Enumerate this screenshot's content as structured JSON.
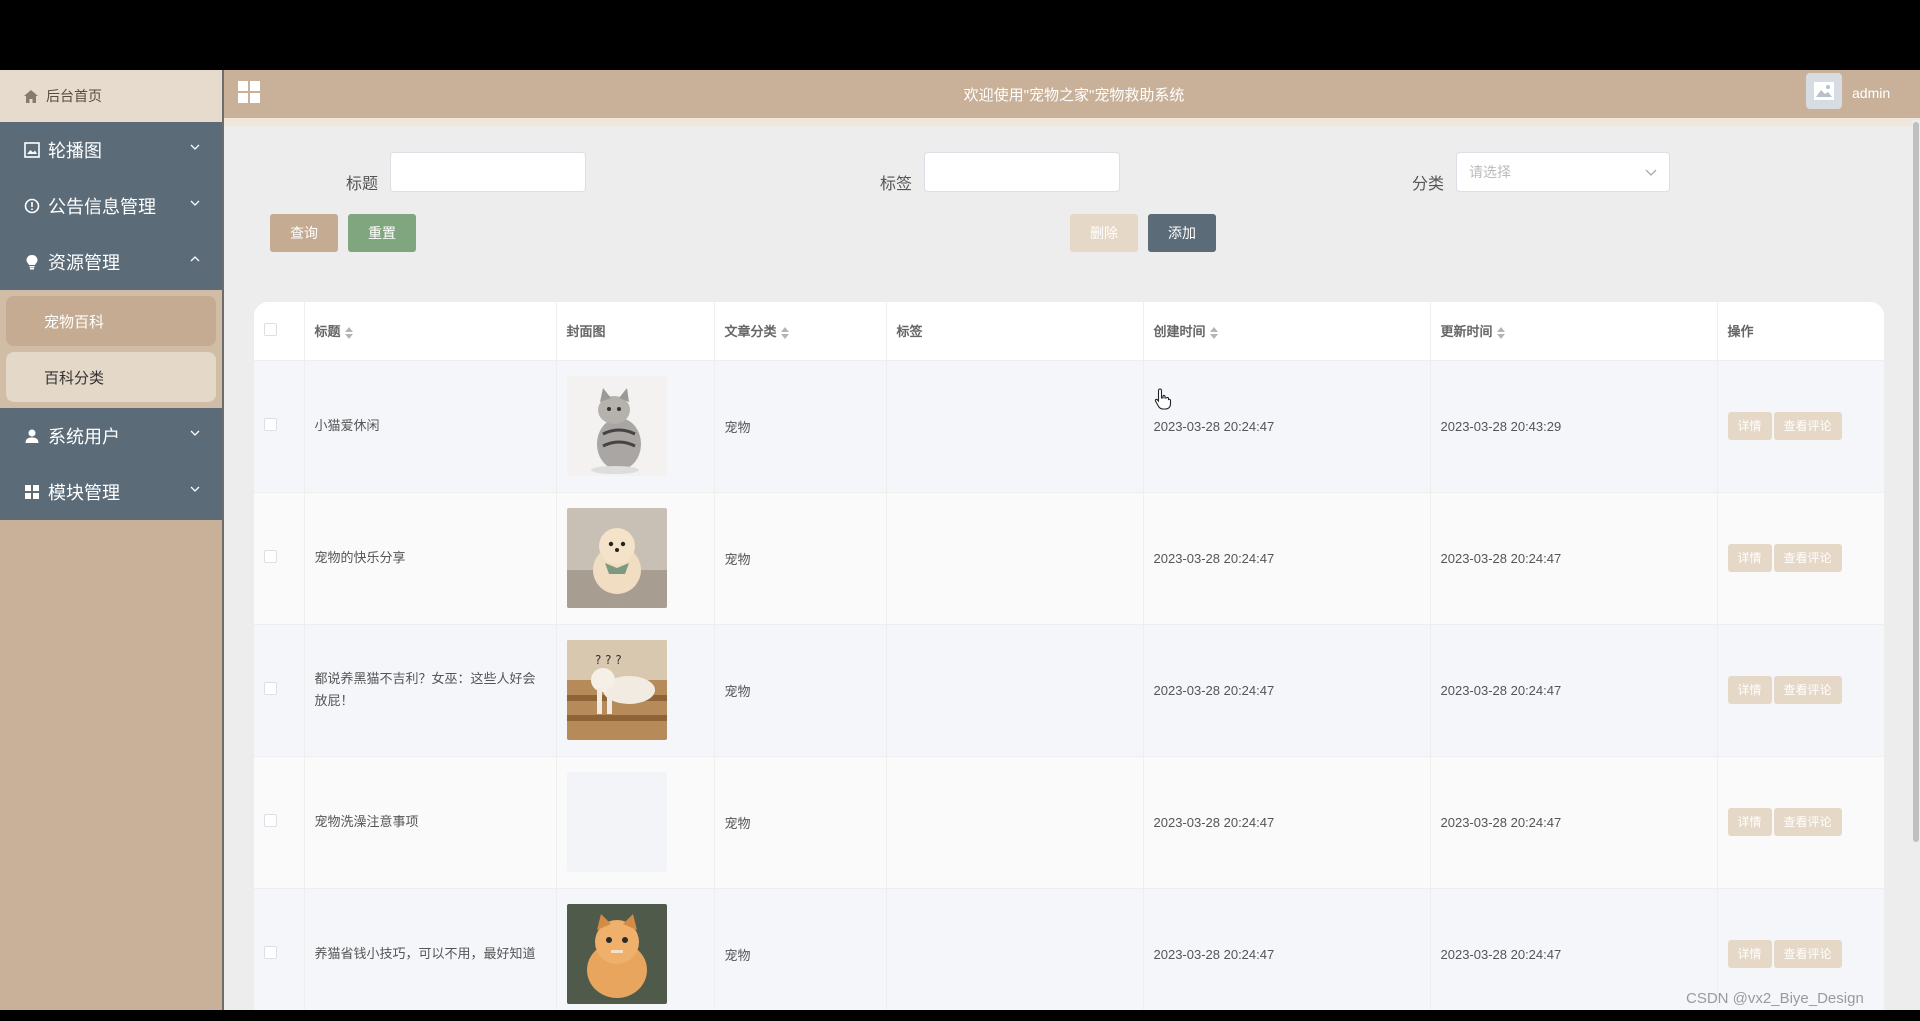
{
  "header": {
    "title": "欢迎使用\"宠物之家\"宠物救助系统",
    "user": "admin"
  },
  "sidebar": {
    "home": "后台首页",
    "items": [
      {
        "label": "轮播图"
      },
      {
        "label": "公告信息管理"
      },
      {
        "label": "资源管理"
      },
      {
        "label": "系统用户"
      },
      {
        "label": "模块管理"
      }
    ],
    "submenu": [
      {
        "label": "宠物百科"
      },
      {
        "label": "百科分类"
      }
    ]
  },
  "search": {
    "title_label": "标题",
    "tag_label": "标签",
    "category_label": "分类",
    "category_placeholder": "请选择",
    "query": "查询",
    "reset": "重置",
    "delete": "删除",
    "add": "添加"
  },
  "table": {
    "headers": [
      "标题",
      "封面图",
      "文章分类",
      "标签",
      "创建时间",
      "更新时间",
      "操作"
    ],
    "rows": [
      {
        "title": "小猫爱休闲",
        "category": "宠物",
        "tag": "",
        "created": "2023-03-28 20:24:47",
        "updated": "2023-03-28 20:43:29"
      },
      {
        "title": "宠物的快乐分享",
        "category": "宠物",
        "tag": "",
        "created": "2023-03-28 20:24:47",
        "updated": "2023-03-28 20:24:47"
      },
      {
        "title": "都说养黑猫不吉利？女巫：这些人好会放屁！",
        "category": "宠物",
        "tag": "",
        "created": "2023-03-28 20:24:47",
        "updated": "2023-03-28 20:24:47"
      },
      {
        "title": "宠物洗澡注意事项",
        "category": "宠物",
        "tag": "",
        "created": "2023-03-28 20:24:47",
        "updated": "2023-03-28 20:24:47"
      },
      {
        "title": "养猫省钱小技巧，可以不用，最好知道",
        "category": "宠物",
        "tag": "",
        "created": "2023-03-28 20:24:47",
        "updated": "2023-03-28 20:24:47"
      }
    ],
    "op_detail": "详情",
    "op_comments": "查看评论"
  },
  "watermark": "CSDN @vx2_Biye_Design",
  "colors": {
    "sidebar": "#c9b199",
    "menu": "#5b6b78",
    "accent": "#c4ab91",
    "reset": "#7fa67e"
  }
}
